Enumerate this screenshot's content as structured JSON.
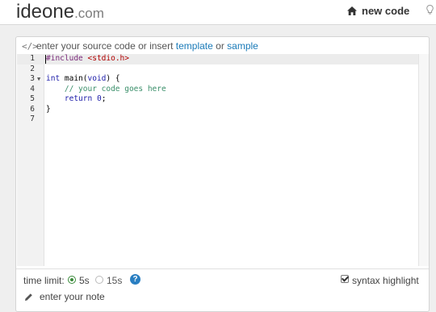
{
  "header": {
    "logo_main": "ideone",
    "logo_tld": ".com",
    "new_code_label": "new code",
    "home_icon": "home-icon",
    "bulb_icon": "lightbulb-icon"
  },
  "editor_panel": {
    "prompt_prefix": "enter your source code or insert",
    "template_link": "template",
    "or_text": "or",
    "sample_link": "sample",
    "code_icon_glyph": "</>",
    "lines": [
      {
        "number": "1",
        "text": "#include <stdio.h>"
      },
      {
        "number": "2",
        "text": ""
      },
      {
        "number": "3",
        "text": "int main(void) {"
      },
      {
        "number": "4",
        "text": "    // your code goes here"
      },
      {
        "number": "5",
        "text": "    return 0;"
      },
      {
        "number": "6",
        "text": "}"
      },
      {
        "number": "7",
        "text": ""
      }
    ]
  },
  "options": {
    "time_limit_label": "time limit:",
    "time_option_1": "5s",
    "time_option_2": "15s",
    "selected_time": "5s",
    "help_glyph": "?",
    "syntax_highlight_label": "syntax highlight",
    "syntax_highlight_checked": true
  },
  "note": {
    "placeholder": "enter your note"
  },
  "colors": {
    "link": "#1a7ab8",
    "radio_selected": "#3a8a3a",
    "help_badge": "#2a7fc2"
  }
}
